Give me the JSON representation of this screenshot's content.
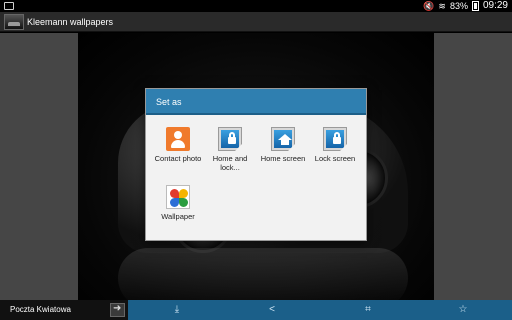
{
  "status_bar": {
    "battery": "83%",
    "time": "09:29"
  },
  "action_bar": {
    "title": "Kleemann wallpapers"
  },
  "dialog": {
    "title": "Set as",
    "options": [
      {
        "label": "Contact photo",
        "icon": "contact-icon"
      },
      {
        "label": "Home and lock...",
        "icon": "home-and-lock-icon"
      },
      {
        "label": "Home screen",
        "icon": "home-screen-icon"
      },
      {
        "label": "Lock screen",
        "icon": "lock-screen-icon"
      },
      {
        "label": "Wallpaper",
        "icon": "wallpaper-icon"
      }
    ]
  },
  "ad_bar": {
    "text": "Poczta Kwiatowa"
  },
  "bottom_bar": {
    "icons": [
      "download-icon",
      "share-icon",
      "crop-icon",
      "star-icon"
    ]
  }
}
